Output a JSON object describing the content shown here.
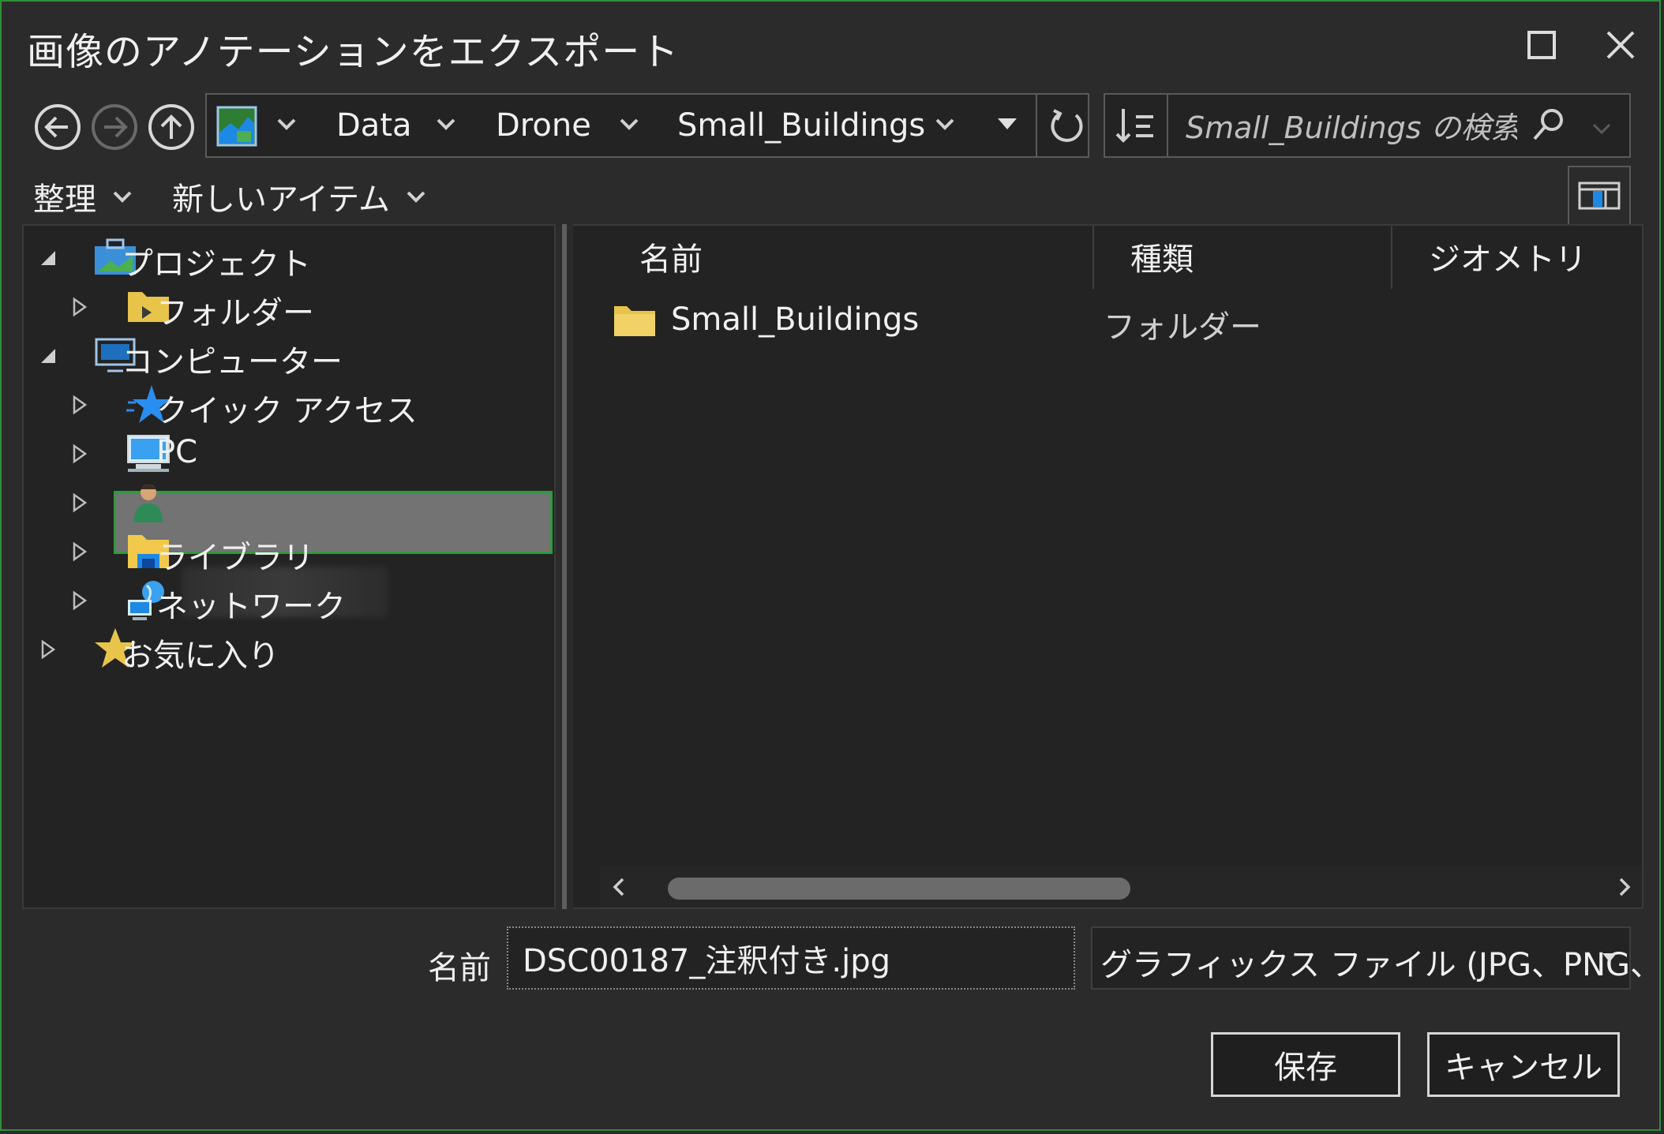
{
  "window": {
    "title": "画像のアノテーションをエクスポート",
    "maximize_icon": "maximize-icon",
    "close_icon": "close-icon"
  },
  "navigation": {
    "back_icon": "back-arrow-icon",
    "forward_icon": "forward-arrow-icon",
    "up_icon": "up-arrow-icon",
    "breadcrumb": [
      "Data",
      "Drone",
      "Small_Buildings"
    ],
    "refresh_icon": "refresh-icon",
    "sort_icon": "sort-icon",
    "search_placeholder": "Small_Buildings の検索"
  },
  "toolbar": {
    "organize": "整理",
    "new_item": "新しいアイテム"
  },
  "tree": {
    "items": [
      {
        "label": "プロジェクト",
        "icon": "project-icon",
        "expanded": true
      },
      {
        "label": "フォルダー",
        "icon": "folder-icon"
      },
      {
        "label": "コンピューター",
        "icon": "computer-icon",
        "expanded": true
      },
      {
        "label": "クイック アクセス",
        "icon": "quick-access-star-icon"
      },
      {
        "label": "PC",
        "icon": "pc-icon",
        "selected": true
      },
      {
        "label": "",
        "icon": "user-icon"
      },
      {
        "label": "ライブラリ",
        "icon": "library-icon"
      },
      {
        "label": "ネットワーク",
        "icon": "network-icon"
      },
      {
        "label": "お気に入り",
        "icon": "favorites-star-icon"
      }
    ]
  },
  "list": {
    "columns": [
      "名前",
      "種類",
      "ジオメトリ"
    ],
    "rows": [
      {
        "name": "Small_Buildings",
        "type": "フォルダー",
        "icon": "folder-icon"
      }
    ]
  },
  "footer": {
    "name_label": "名前",
    "filename": "DSC00187_注釈付き.jpg",
    "filetype": "グラフィックス ファイル (JPG、PNG、BM",
    "save": "保存",
    "cancel": "キャンセル"
  },
  "colors": {
    "accent_green": "#2f9a3c",
    "background": "#2b2b2b",
    "panel": "#232323",
    "selection": "#737373"
  }
}
